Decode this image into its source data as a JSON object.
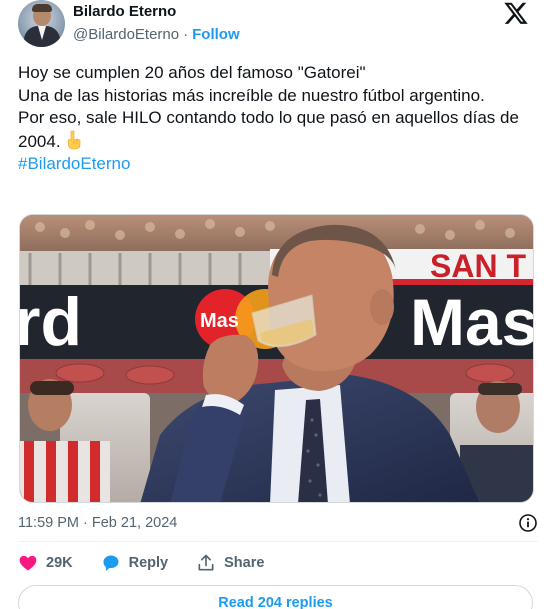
{
  "author": {
    "display_name": "Bilardo Eterno",
    "handle": "@BilardoEterno",
    "separator": "·",
    "follow_label": "Follow"
  },
  "tweet": {
    "lines": [
      "Hoy se cumplen 20 años del famoso \"Gatorei\"",
      "Una de las historias más increíble de nuestro fútbol argentino.",
      "Por eso, sale HILO contando todo lo que pasó en aquellos días de 2004."
    ],
    "hashtag": "#BilardoEterno",
    "emoji": "pointing-down-emoji"
  },
  "photo": {
    "banner_text_left": "rd",
    "banner_text_right": "Mas",
    "stadium_text": "SAN T",
    "logo_text": "Mas"
  },
  "meta": {
    "timestamp": "11:59 PM · Feb 21, 2024"
  },
  "actions": {
    "likes": "29K",
    "reply_label": "Reply",
    "share_label": "Share"
  },
  "read_replies_label": "Read 204 replies",
  "colors": {
    "accent": "#1d9bf0",
    "like": "#f91880",
    "secondary_text": "#536471"
  }
}
